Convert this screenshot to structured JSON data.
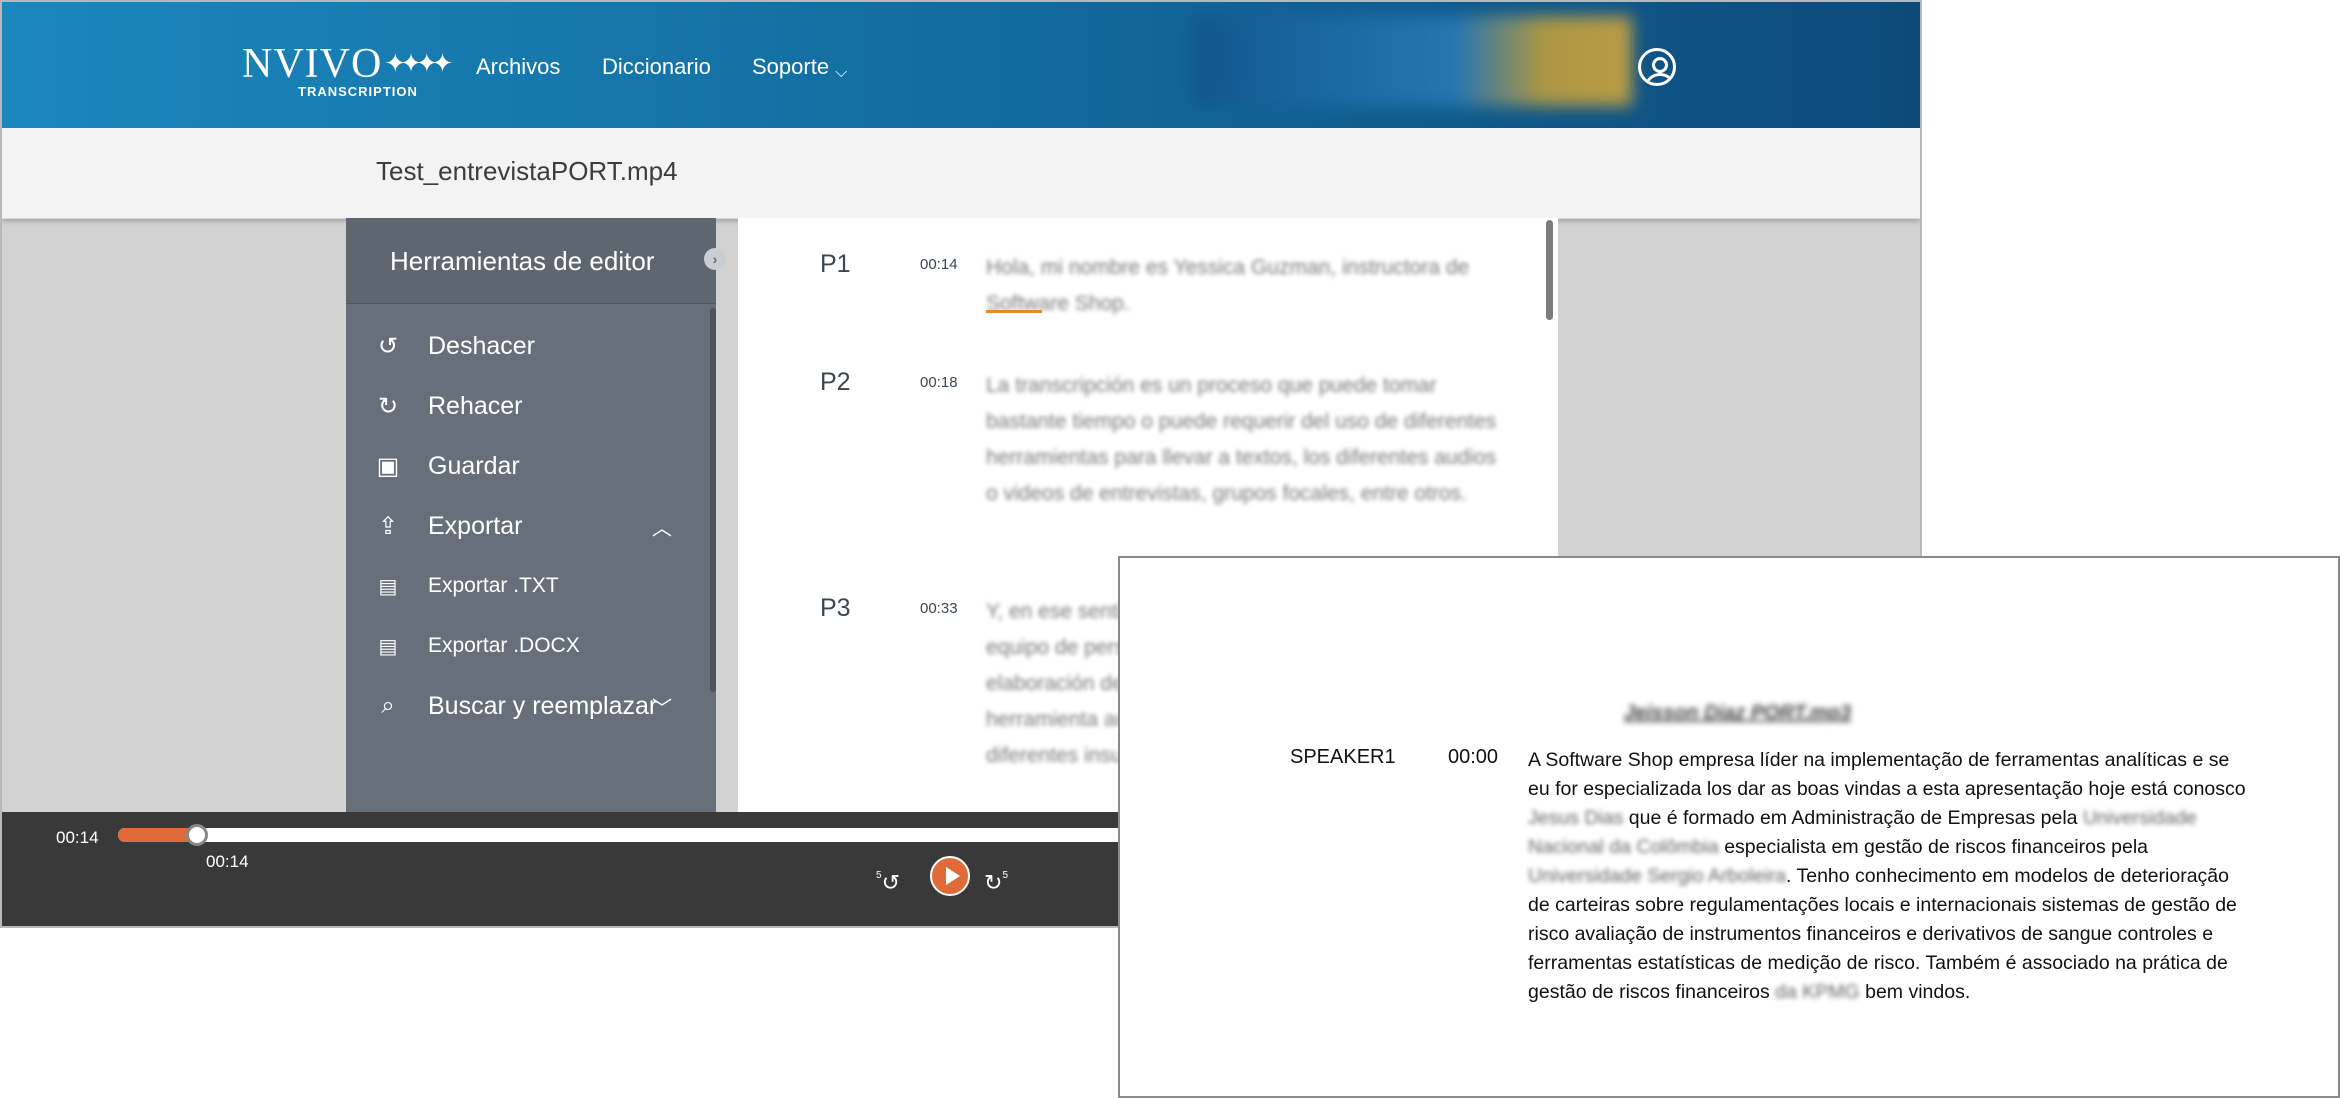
{
  "app": {
    "logo": {
      "text": "NVIVO",
      "stars": "✦✦✦✦",
      "subtitle": "TRANSCRIPTION"
    },
    "nav": {
      "archivos": "Archivos",
      "diccionario": "Diccionario",
      "soporte": "Soporte"
    },
    "file_title": "Test_entrevistaPORT.mp4"
  },
  "tools": {
    "title": "Herramientas de editor",
    "items": [
      {
        "label": "Deshacer",
        "icon": "undo-icon"
      },
      {
        "label": "Rehacer",
        "icon": "redo-icon"
      },
      {
        "label": "Guardar",
        "icon": "save-icon"
      },
      {
        "label": "Exportar",
        "icon": "export-icon"
      },
      {
        "label": "Exportar .TXT",
        "icon": "document-icon"
      },
      {
        "label": "Exportar .DOCX",
        "icon": "document-icon"
      },
      {
        "label": "Buscar y reemplazar",
        "icon": "search-replace-icon"
      }
    ]
  },
  "transcript": {
    "paragraphs": [
      {
        "id": "P1",
        "time": "00:14",
        "text": "Hola, mi nombre es Yessica Guzman, instructora de Software Shop."
      },
      {
        "id": "P2",
        "time": "00:18",
        "text": "La transcripción es un proceso que puede tomar bastante tiempo o puede requerir del uso de diferentes herramientas para llevar a textos, los diferentes audios o videos de entrevistas, grupos focales, entre otros."
      },
      {
        "id": "P3",
        "time": "00:33",
        "text": "Y, en ese sentido, este proceso puede requerir de un equipo de personas y esto puede tener atrasos en la elaboración de los informes. En este caso, con una herramienta automatizada, podemos transcribir los diferentes insumos..."
      }
    ]
  },
  "player": {
    "elapsed": "00:14",
    "knob_time": "00:14",
    "progress": 0.066,
    "skip_seconds": "5"
  },
  "document": {
    "title": "Jeisson Diaz PORT.mp3",
    "speaker": "SPEAKER1",
    "time": "00:00",
    "segments": [
      {
        "text": "A Software Shop empresa líder na implementação de ferramentas analíticas e se eu for especializada los dar as boas vindas a esta apresentação hoje está conosco ",
        "blur": false
      },
      {
        "text": "Jesus Dias",
        "blur": true
      },
      {
        "text": " que é formado em Administração de Empresas pela ",
        "blur": false
      },
      {
        "text": "Universidade Nacional da Colômbia",
        "blur": true
      },
      {
        "text": " especialista em gestão de riscos financeiros pela ",
        "blur": false
      },
      {
        "text": "Universidade Sergio Arboleira",
        "blur": true
      },
      {
        "text": ". Tenho conhecimento em modelos de deterioração de carteiras sobre regulamentações locais e internacionais sistemas de gestão de risco avaliação de instrumentos financeiros e derivativos de sangue controles e ferramentas estatísticas de medição de risco. Também é associado na prática de gestão de riscos financeiros ",
        "blur": false
      },
      {
        "text": "da KPMG",
        "blur": true
      },
      {
        "text": " bem vindos.",
        "blur": false
      }
    ]
  },
  "colors": {
    "header_start": "#1b87bd",
    "header_end": "#0d4a7a",
    "accent": "#e06a38",
    "sidebar": "#67707a"
  }
}
